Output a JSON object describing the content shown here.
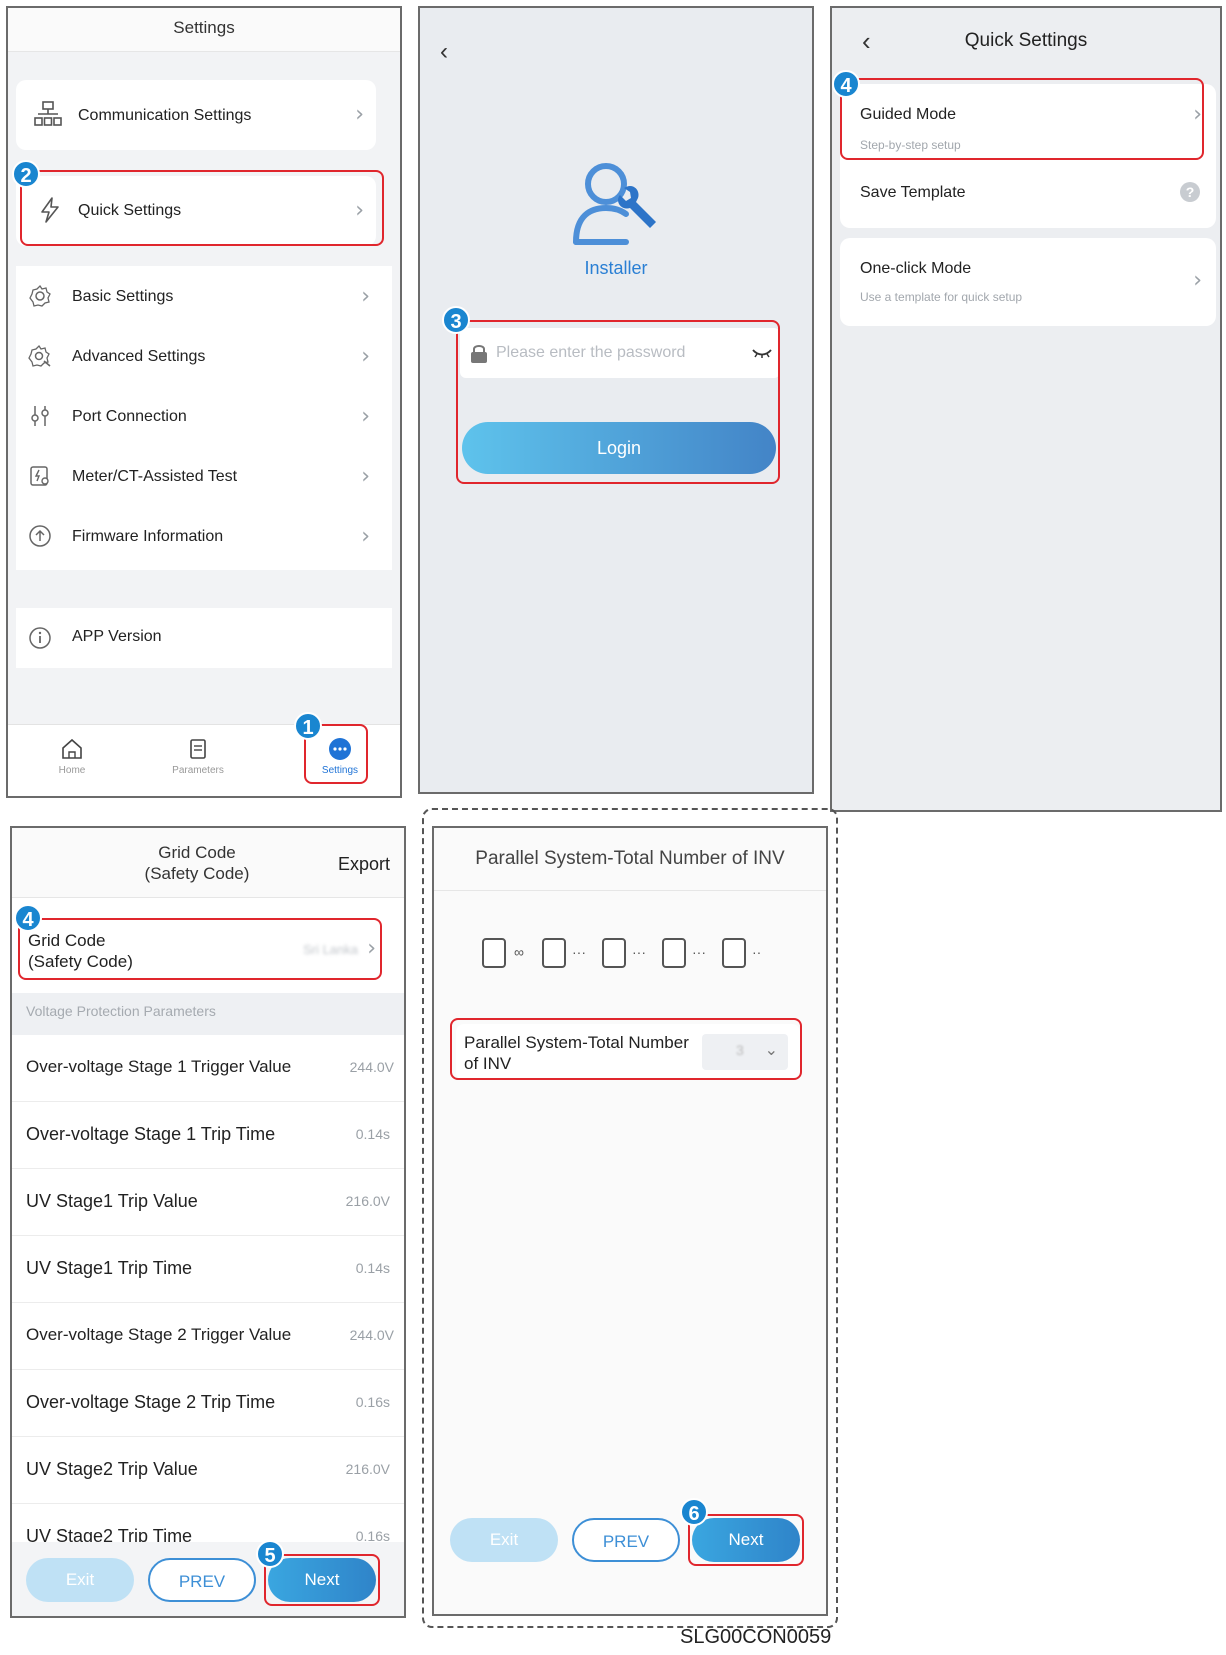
{
  "settings_screen": {
    "title": "Settings",
    "items": [
      {
        "label": "Communication Settings",
        "icon": "network-icon"
      },
      {
        "label": "Quick Settings",
        "icon": "lightning-icon"
      },
      {
        "label": "Basic Settings",
        "icon": "gear-icon"
      },
      {
        "label": "Advanced Settings",
        "icon": "advanced-gear-icon"
      },
      {
        "label": "Port Connection",
        "icon": "port-icon"
      },
      {
        "label": "Meter/CT-Assisted Test",
        "icon": "meter-icon"
      },
      {
        "label": "Firmware Information",
        "icon": "upload-icon"
      },
      {
        "label": "APP Version",
        "icon": "info-icon"
      }
    ],
    "tabs": [
      {
        "label": "Home",
        "icon": "home-icon"
      },
      {
        "label": "Parameters",
        "icon": "document-icon"
      },
      {
        "label": "Settings",
        "icon": "more-icon"
      }
    ]
  },
  "login_screen": {
    "role_label": "Installer",
    "password_placeholder": "Please enter the password",
    "login_label": "Login"
  },
  "quick_settings_screen": {
    "title": "Quick Settings",
    "guided_mode": {
      "label": "Guided Mode",
      "subtitle": "Step-by-step setup"
    },
    "save_template": {
      "label": "Save Template"
    },
    "one_click_mode": {
      "label": "One-click Mode",
      "subtitle": "Use a template for quick setup"
    }
  },
  "grid_code_screen": {
    "title_line1": "Grid Code",
    "title_line2": "(Safety Code)",
    "export_label": "Export",
    "grid_code_line1": "Grid Code",
    "grid_code_line2": "(Safety Code)",
    "grid_code_value": "Sri Lanka",
    "section_label": "Voltage Protection Parameters",
    "params": [
      {
        "label": "Over-voltage Stage 1 Trigger Value",
        "value": "244.0V"
      },
      {
        "label": "Over-voltage Stage 1 Trip Time",
        "value": "0.14s"
      },
      {
        "label": "UV Stage1 Trip Value",
        "value": "216.0V"
      },
      {
        "label": "UV Stage1 Trip Time",
        "value": "0.14s"
      },
      {
        "label": "Over-voltage Stage 2 Trigger Value",
        "value": "244.0V"
      },
      {
        "label": "Over-voltage Stage 2 Trip Time",
        "value": "0.16s"
      },
      {
        "label": "UV Stage2 Trip Value",
        "value": "216.0V"
      },
      {
        "label": "UV Stage2 Trip Time",
        "value": "0.16s"
      }
    ],
    "buttons": {
      "exit": "Exit",
      "prev": "PREV",
      "next": "Next"
    }
  },
  "parallel_screen": {
    "title": "Parallel System-Total Number of INV",
    "field_line1": "Parallel System-Total Number",
    "field_line2": "of INV",
    "field_value": "3",
    "buttons": {
      "exit": "Exit",
      "prev": "PREV",
      "next": "Next"
    }
  },
  "step_badges": [
    "1",
    "2",
    "3",
    "4",
    "4",
    "5",
    "6"
  ],
  "figure_id": "SLG00CON0059",
  "colors": {
    "accent": "#1a86d0",
    "highlight": "#e0262d",
    "installer_blue": "#2a7fd4"
  }
}
